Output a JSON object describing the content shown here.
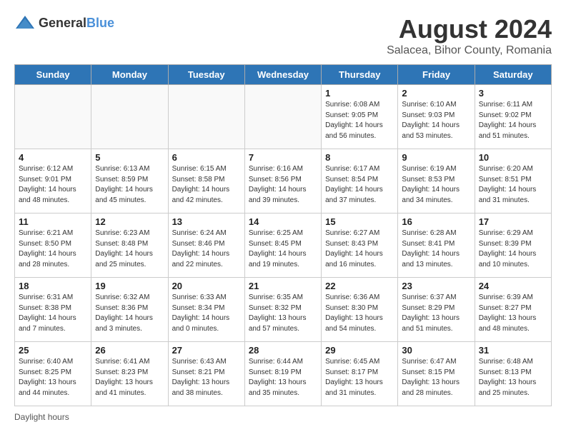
{
  "header": {
    "logo_general": "General",
    "logo_blue": "Blue",
    "title": "August 2024",
    "subtitle": "Salacea, Bihor County, Romania"
  },
  "days_of_week": [
    "Sunday",
    "Monday",
    "Tuesday",
    "Wednesday",
    "Thursday",
    "Friday",
    "Saturday"
  ],
  "weeks": [
    [
      {
        "day": "",
        "info": "",
        "empty": true
      },
      {
        "day": "",
        "info": "",
        "empty": true
      },
      {
        "day": "",
        "info": "",
        "empty": true
      },
      {
        "day": "",
        "info": "",
        "empty": true
      },
      {
        "day": "1",
        "info": "Sunrise: 6:08 AM\nSunset: 9:05 PM\nDaylight: 14 hours\nand 56 minutes."
      },
      {
        "day": "2",
        "info": "Sunrise: 6:10 AM\nSunset: 9:03 PM\nDaylight: 14 hours\nand 53 minutes."
      },
      {
        "day": "3",
        "info": "Sunrise: 6:11 AM\nSunset: 9:02 PM\nDaylight: 14 hours\nand 51 minutes."
      }
    ],
    [
      {
        "day": "4",
        "info": "Sunrise: 6:12 AM\nSunset: 9:01 PM\nDaylight: 14 hours\nand 48 minutes."
      },
      {
        "day": "5",
        "info": "Sunrise: 6:13 AM\nSunset: 8:59 PM\nDaylight: 14 hours\nand 45 minutes."
      },
      {
        "day": "6",
        "info": "Sunrise: 6:15 AM\nSunset: 8:58 PM\nDaylight: 14 hours\nand 42 minutes."
      },
      {
        "day": "7",
        "info": "Sunrise: 6:16 AM\nSunset: 8:56 PM\nDaylight: 14 hours\nand 39 minutes."
      },
      {
        "day": "8",
        "info": "Sunrise: 6:17 AM\nSunset: 8:54 PM\nDaylight: 14 hours\nand 37 minutes."
      },
      {
        "day": "9",
        "info": "Sunrise: 6:19 AM\nSunset: 8:53 PM\nDaylight: 14 hours\nand 34 minutes."
      },
      {
        "day": "10",
        "info": "Sunrise: 6:20 AM\nSunset: 8:51 PM\nDaylight: 14 hours\nand 31 minutes."
      }
    ],
    [
      {
        "day": "11",
        "info": "Sunrise: 6:21 AM\nSunset: 8:50 PM\nDaylight: 14 hours\nand 28 minutes."
      },
      {
        "day": "12",
        "info": "Sunrise: 6:23 AM\nSunset: 8:48 PM\nDaylight: 14 hours\nand 25 minutes."
      },
      {
        "day": "13",
        "info": "Sunrise: 6:24 AM\nSunset: 8:46 PM\nDaylight: 14 hours\nand 22 minutes."
      },
      {
        "day": "14",
        "info": "Sunrise: 6:25 AM\nSunset: 8:45 PM\nDaylight: 14 hours\nand 19 minutes."
      },
      {
        "day": "15",
        "info": "Sunrise: 6:27 AM\nSunset: 8:43 PM\nDaylight: 14 hours\nand 16 minutes."
      },
      {
        "day": "16",
        "info": "Sunrise: 6:28 AM\nSunset: 8:41 PM\nDaylight: 14 hours\nand 13 minutes."
      },
      {
        "day": "17",
        "info": "Sunrise: 6:29 AM\nSunset: 8:39 PM\nDaylight: 14 hours\nand 10 minutes."
      }
    ],
    [
      {
        "day": "18",
        "info": "Sunrise: 6:31 AM\nSunset: 8:38 PM\nDaylight: 14 hours\nand 7 minutes."
      },
      {
        "day": "19",
        "info": "Sunrise: 6:32 AM\nSunset: 8:36 PM\nDaylight: 14 hours\nand 3 minutes."
      },
      {
        "day": "20",
        "info": "Sunrise: 6:33 AM\nSunset: 8:34 PM\nDaylight: 14 hours\nand 0 minutes."
      },
      {
        "day": "21",
        "info": "Sunrise: 6:35 AM\nSunset: 8:32 PM\nDaylight: 13 hours\nand 57 minutes."
      },
      {
        "day": "22",
        "info": "Sunrise: 6:36 AM\nSunset: 8:30 PM\nDaylight: 13 hours\nand 54 minutes."
      },
      {
        "day": "23",
        "info": "Sunrise: 6:37 AM\nSunset: 8:29 PM\nDaylight: 13 hours\nand 51 minutes."
      },
      {
        "day": "24",
        "info": "Sunrise: 6:39 AM\nSunset: 8:27 PM\nDaylight: 13 hours\nand 48 minutes."
      }
    ],
    [
      {
        "day": "25",
        "info": "Sunrise: 6:40 AM\nSunset: 8:25 PM\nDaylight: 13 hours\nand 44 minutes."
      },
      {
        "day": "26",
        "info": "Sunrise: 6:41 AM\nSunset: 8:23 PM\nDaylight: 13 hours\nand 41 minutes."
      },
      {
        "day": "27",
        "info": "Sunrise: 6:43 AM\nSunset: 8:21 PM\nDaylight: 13 hours\nand 38 minutes."
      },
      {
        "day": "28",
        "info": "Sunrise: 6:44 AM\nSunset: 8:19 PM\nDaylight: 13 hours\nand 35 minutes."
      },
      {
        "day": "29",
        "info": "Sunrise: 6:45 AM\nSunset: 8:17 PM\nDaylight: 13 hours\nand 31 minutes."
      },
      {
        "day": "30",
        "info": "Sunrise: 6:47 AM\nSunset: 8:15 PM\nDaylight: 13 hours\nand 28 minutes."
      },
      {
        "day": "31",
        "info": "Sunrise: 6:48 AM\nSunset: 8:13 PM\nDaylight: 13 hours\nand 25 minutes."
      }
    ]
  ],
  "footer": {
    "note": "Daylight hours"
  }
}
